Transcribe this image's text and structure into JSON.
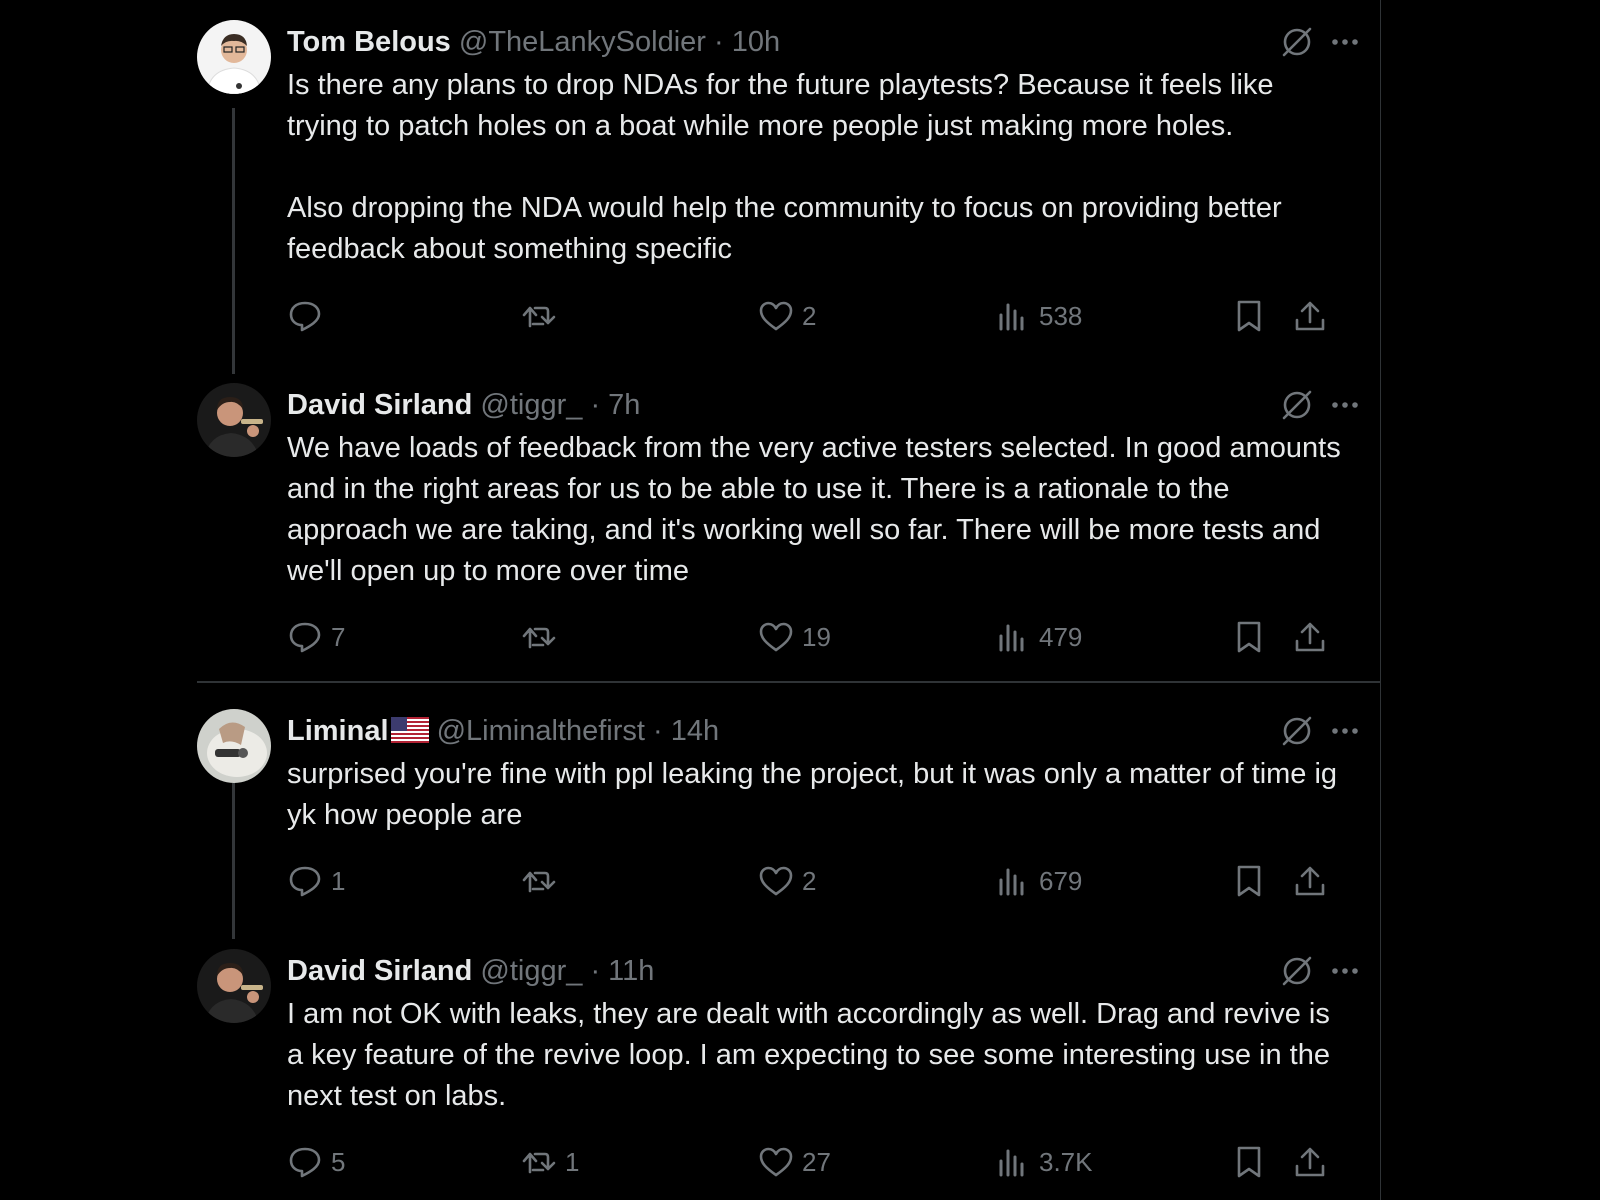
{
  "tweets": [
    {
      "name": "Tom Belous",
      "handle": "@TheLankySoldier",
      "sep": "·",
      "time": "10h",
      "body": [
        "Is there any plans to drop NDAs for the future playtests? Because it feels like trying to patch holes on a boat while more people just making more holes.",
        "Also dropping the NDA would help the community to focus on providing better feedback about something specific"
      ],
      "replies": "",
      "reposts": "",
      "likes": "2",
      "views": "538"
    },
    {
      "name": "David Sirland",
      "handle": "@tiggr_",
      "sep": "·",
      "time": "7h",
      "body": [
        "We have loads of feedback from the very active testers selected. In good amounts and in the right areas for us to be able to use it. There is a rationale to the approach we are taking, and it's working well so far. There will be more tests and we'll open up to more over time"
      ],
      "replies": "7",
      "reposts": "",
      "likes": "19",
      "views": "479"
    },
    {
      "name": "Liminal",
      "handle": "@Liminalthefirst",
      "sep": "·",
      "time": "14h",
      "body": [
        "surprised you're fine with ppl leaking the project, but it was only a matter of time ig yk how people are"
      ],
      "replies": "1",
      "reposts": "",
      "likes": "2",
      "views": "679"
    },
    {
      "name": "David Sirland",
      "handle": "@tiggr_",
      "sep": "·",
      "time": "11h",
      "body": [
        "I am not OK with leaks, they are dealt with accordingly as well. Drag and revive is a key feature of the revive loop. I am expecting to see some interesting use in the next test on labs."
      ],
      "replies": "5",
      "reposts": "1",
      "likes": "27",
      "views": "3.7K"
    }
  ],
  "icons": {
    "reply": "reply-icon",
    "repost": "repost-icon",
    "like": "like-icon",
    "views": "views-icon",
    "bookmark": "bookmark-icon",
    "share": "share-icon",
    "grok": "grok-icon",
    "more": "more-icon",
    "flag": "us-flag-icon"
  },
  "colors": {
    "background": "#000000",
    "text": "#e7e9ea",
    "muted": "#71767b",
    "border": "#2f3336"
  }
}
